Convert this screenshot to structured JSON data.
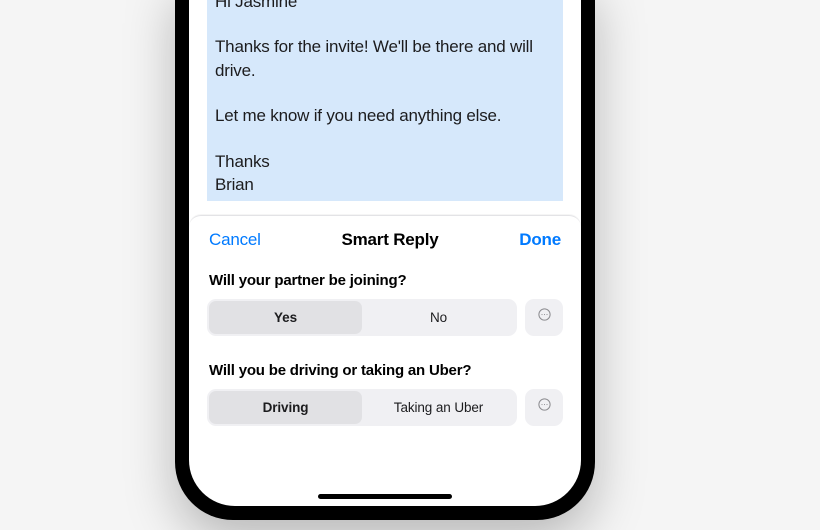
{
  "email": {
    "greeting": "Hi Jasmine",
    "body1": "Thanks for the invite! We'll be there and will drive.",
    "body2": "Let me know if you need anything else.",
    "signoff": "Thanks",
    "sender": "Brian"
  },
  "sheet": {
    "cancel": "Cancel",
    "title": "Smart Reply",
    "done": "Done"
  },
  "q1": {
    "prompt": "Will your partner be joining?",
    "opt_a": "Yes",
    "opt_b": "No"
  },
  "q2": {
    "prompt": "Will you be driving or taking an Uber?",
    "opt_a": "Driving",
    "opt_b": "Taking an Uber"
  }
}
